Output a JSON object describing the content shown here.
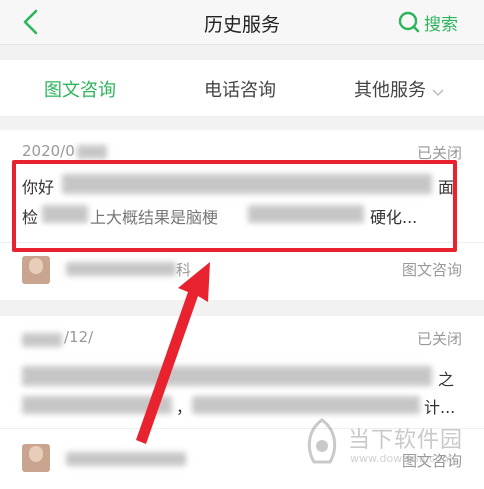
{
  "header": {
    "title": "历史服务",
    "search_label": "搜索",
    "accent_color": "#2db55d"
  },
  "tabs": [
    {
      "label": "图文咨询",
      "active": true
    },
    {
      "label": "电话咨询",
      "active": false
    },
    {
      "label": "其他服务",
      "active": false
    }
  ],
  "records": [
    {
      "date_visible": "2020/0",
      "status": "已关闭",
      "line1_start": "你好",
      "line1_end": "面",
      "line2_start": "检",
      "line2_mid": "上大概结果是脑梗",
      "line2_end": "硬化...",
      "doctor_suffix": "科",
      "type": "图文咨询"
    },
    {
      "date_visible": "/12/",
      "status": "已关闭",
      "line1_end": "之",
      "line2_mid": "，",
      "line2_end": "计...",
      "type": "图文咨询"
    }
  ],
  "annotation": {
    "color": "#e8232f"
  },
  "watermark": {
    "text": "当下软件园",
    "url": "www.downxia.com"
  }
}
